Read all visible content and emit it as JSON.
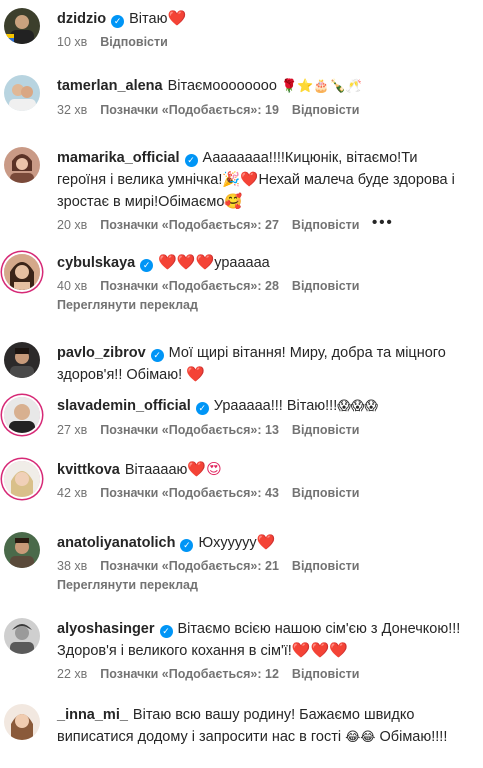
{
  "icons": {
    "verified": "verified-badge-icon",
    "more": "more-options-icon"
  },
  "colors": {
    "verified": "#0095f6",
    "secondary_text": "#737373",
    "story_ring": "#d62976"
  },
  "comments": [
    {
      "username": "dzidzio",
      "verified": true,
      "text": "Вітаю",
      "emoji": "❤️",
      "time": "10 хв",
      "likes": "",
      "reply": "Відповісти"
    },
    {
      "username": "tamerlan_alena",
      "verified": false,
      "text": "Вітаємоооооооо",
      "emoji": "🌹⭐🎂🍾🥂",
      "time": "32 хв",
      "likes": "Позначки «Подобається»: 19",
      "reply": "Відповісти"
    },
    {
      "username": "mamarika_official",
      "verified": true,
      "text": "Аааааааа!!!!Кицюнік, вітаємо!Ти героїня і велика умнічка!🎉❤️Нехай малеча буде здорова і зростає в мирі!Обімаємо🥰",
      "time": "20 хв",
      "likes": "Позначки «Подобається»: 27",
      "reply": "Відповісти",
      "more": "•••"
    },
    {
      "username": "cybulskaya",
      "verified": true,
      "text": "",
      "emoji": "❤️❤️❤️",
      "text_after": "урааааа",
      "time": "40 хв",
      "likes": "Позначки «Подобається»: 28",
      "reply": "Відповісти",
      "translate": "Переглянути переклад"
    },
    {
      "username": "pavlo_zibrov",
      "verified": true,
      "text": "Мої щирі вітання! Миру, добра та міцного здоров'я!! Обімаю!",
      "emoji": "❤️"
    },
    {
      "username": "slavademin_official",
      "verified": true,
      "text": "Урааааа!!! Вітаю!!!",
      "emoji": "😱😱😱",
      "time": "27 хв",
      "likes": "Позначки «Подобається»: 13",
      "reply": "Відповісти"
    },
    {
      "username": "kvittkova",
      "verified": false,
      "text": "Вітааааю",
      "emoji": "❤️😍",
      "time": "42 хв",
      "likes": "Позначки «Подобається»: 43",
      "reply": "Відповісти"
    },
    {
      "username": "anatoliyanatolich",
      "verified": true,
      "text": "Юхуyyyy",
      "emoji": "❤️",
      "time": "38 хв",
      "likes": "Позначки «Подобається»: 21",
      "reply": "Відповісти",
      "translate": "Переглянути переклад"
    },
    {
      "username": "alyoshasinger",
      "verified": true,
      "text": "Вітаємо всією нашою сім'єю з Донечкою!!! Здоров'я і великого кохання в сім'ї!",
      "emoji": "❤️❤️❤️",
      "time": "22 хв",
      "likes": "Позначки «Подобається»: 12",
      "reply": "Відповісти"
    },
    {
      "username": "_inna_mi_",
      "verified": false,
      "text": "Вітаю всю вашу родину! Бажаємо швидко виписатися додому і запросити нас в гості",
      "emoji": "😂😂",
      "text_after": "Обімаю!!!!"
    }
  ]
}
